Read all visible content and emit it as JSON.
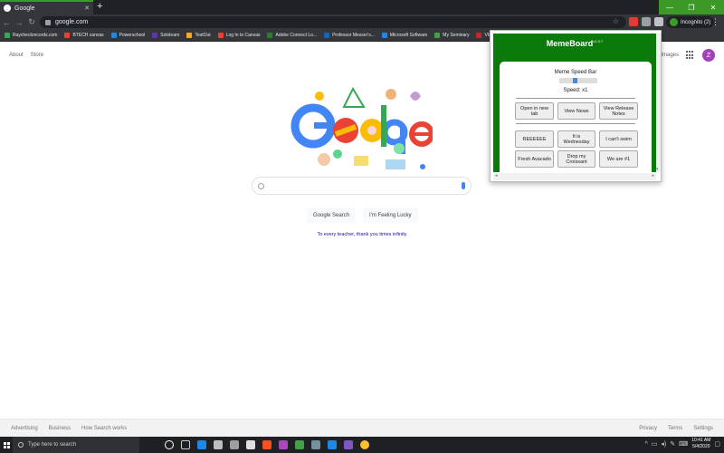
{
  "browser": {
    "tab_title": "Google",
    "url": "google.com",
    "incognito_label": "Incognito (2)",
    "bookmarks": [
      {
        "label": "Raycheckrecords.com",
        "color": "#34a853"
      },
      {
        "label": "BTECH canvas",
        "color": "#e94235"
      },
      {
        "label": "Powerschool",
        "color": "#1e88e5"
      },
      {
        "label": "Sololearn",
        "color": "#5e35b1"
      },
      {
        "label": "TestOut",
        "color": "#f9a825"
      },
      {
        "label": "Log In to Canvas",
        "color": "#e94235"
      },
      {
        "label": "Adobe Connect Lo...",
        "color": "#2e7d32"
      },
      {
        "label": "Professor Messer's...",
        "color": "#1565c0"
      },
      {
        "label": "Microsoft Software",
        "color": "#1e88e5"
      },
      {
        "label": "My Seminary",
        "color": "#43a047"
      },
      {
        "label": "VEX C",
        "color": "#c62828"
      }
    ]
  },
  "google": {
    "top_left": [
      "About",
      "Store"
    ],
    "images_link": "Images",
    "avatar_letter": "Z",
    "search_placeholder": "",
    "search_button": "Google Search",
    "lucky_button": "I'm Feeling Lucky",
    "doodle_message": "To every teacher, thank you times infinity",
    "footer_left": [
      "Advertising",
      "Business",
      "How Search works"
    ],
    "footer_right": [
      "Privacy",
      "Terms",
      "Settings"
    ]
  },
  "memeboard": {
    "title": "MemeBoard",
    "version": "v1.3.7",
    "speed_bar_label": "Meme Speed Bar",
    "speed_value_text": "Speed: x1",
    "speed_level": 0.4,
    "buttons_row1": [
      "Open in new tab",
      "View News",
      "View Release Notes"
    ],
    "buttons_row2": [
      "REEEEEE",
      "It is Wednesday",
      "I can't swim"
    ],
    "buttons_row3": [
      "Fresh Avacado",
      "Drop my Croissant",
      "We are #1"
    ]
  },
  "taskbar": {
    "search_placeholder": "Type here to search",
    "time": "10:41 AM",
    "date": "5/4/2020"
  }
}
